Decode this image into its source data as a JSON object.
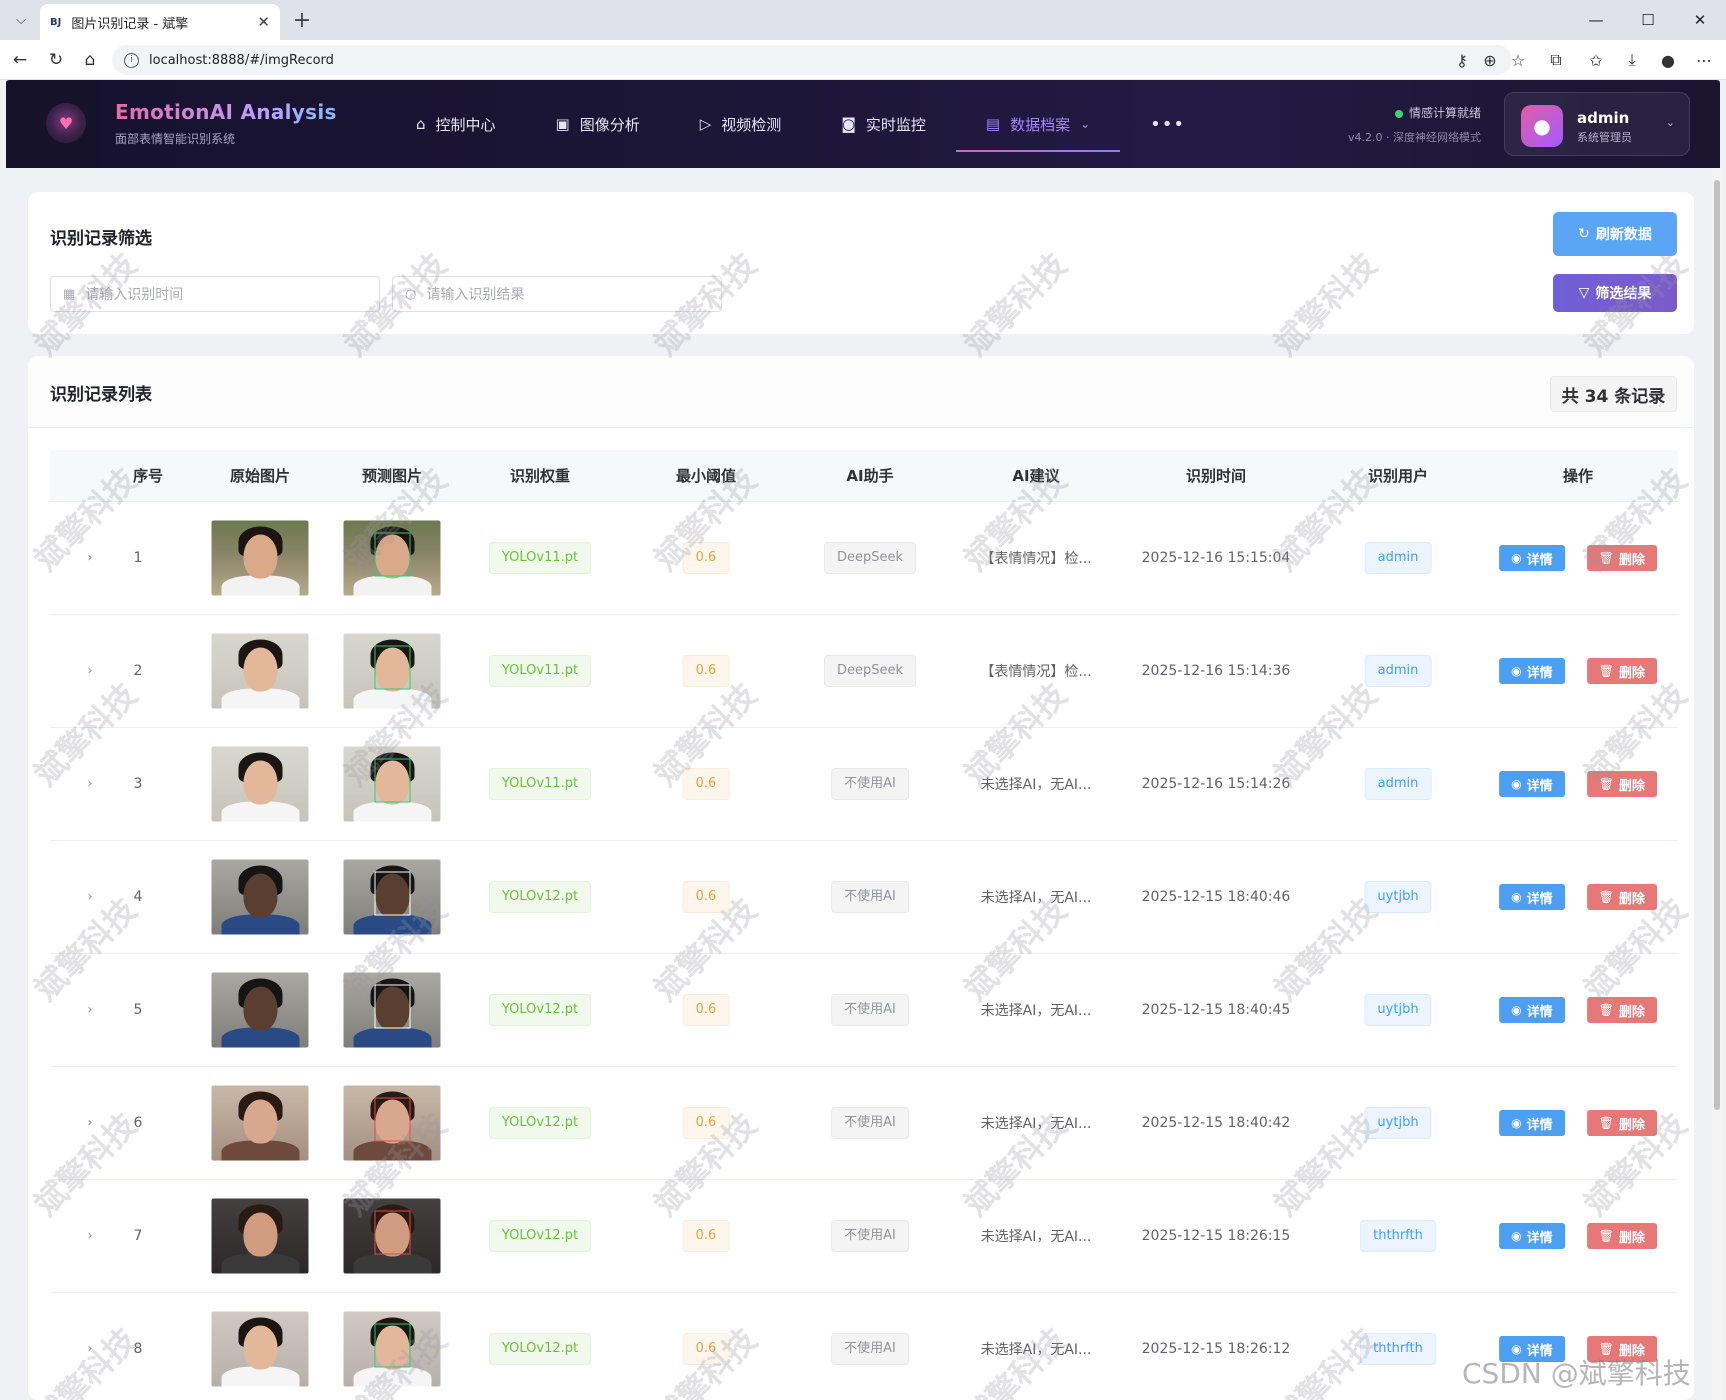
{
  "browser": {
    "tab_title": "图片识别记录 - 斌擎",
    "tab_favicon": "BJ",
    "url": "localhost:8888/#/imgRecord"
  },
  "app": {
    "brand_title": "EmotionAI Analysis",
    "brand_subtitle": "面部表情智能识别系统",
    "nav": [
      {
        "label": "控制中心",
        "icon": "home-icon"
      },
      {
        "label": "图像分析",
        "icon": "image-icon"
      },
      {
        "label": "视频检测",
        "icon": "play-circle-icon"
      },
      {
        "label": "实时监控",
        "icon": "camera-icon"
      },
      {
        "label": "数据档案",
        "icon": "document-icon",
        "active": true
      }
    ],
    "more": "•••",
    "status_text": "情感计算就绪",
    "status_sub": "v4.2.0 · 深度神经网络模式",
    "user_name": "admin",
    "user_role": "系统管理员"
  },
  "filter": {
    "title": "识别记录筛选",
    "time_placeholder": "请输入识别时间",
    "result_placeholder": "请输入识别结果",
    "refresh_label": "刷新数据",
    "filter_label": "筛选结果"
  },
  "list": {
    "title": "识别记录列表",
    "count_label": "共 34 条记录",
    "columns": [
      "序号",
      "原始图片",
      "预测图片",
      "识别权重",
      "最小阈值",
      "AI助手",
      "AI建议",
      "识别时间",
      "识别用户",
      "操作"
    ],
    "view_label": "详情",
    "delete_label": "删除",
    "rows": [
      {
        "index": "1",
        "weight": "YOLOv11.pt",
        "threshold": "0.6",
        "ai": "DeepSeek",
        "advice": "【表情情况】检...",
        "time": "2025-12-16 15:15:04",
        "user": "admin"
      },
      {
        "index": "2",
        "weight": "YOLOv11.pt",
        "threshold": "0.6",
        "ai": "DeepSeek",
        "advice": "【表情情况】检...",
        "time": "2025-12-16 15:14:36",
        "user": "admin"
      },
      {
        "index": "3",
        "weight": "YOLOv11.pt",
        "threshold": "0.6",
        "ai": "不使用AI",
        "advice": "未选择AI，无AI...",
        "time": "2025-12-16 15:14:26",
        "user": "admin"
      },
      {
        "index": "4",
        "weight": "YOLOv12.pt",
        "threshold": "0.6",
        "ai": "不使用AI",
        "advice": "未选择AI，无AI...",
        "time": "2025-12-15 18:40:46",
        "user": "uytjbh"
      },
      {
        "index": "5",
        "weight": "YOLOv12.pt",
        "threshold": "0.6",
        "ai": "不使用AI",
        "advice": "未选择AI，无AI...",
        "time": "2025-12-15 18:40:45",
        "user": "uytjbh"
      },
      {
        "index": "6",
        "weight": "YOLOv12.pt",
        "threshold": "0.6",
        "ai": "不使用AI",
        "advice": "未选择AI，无AI...",
        "time": "2025-12-15 18:40:42",
        "user": "uytjbh"
      },
      {
        "index": "7",
        "weight": "YOLOv12.pt",
        "threshold": "0.6",
        "ai": "不使用AI",
        "advice": "未选择AI，无AI...",
        "time": "2025-12-15 18:26:15",
        "user": "ththrfth"
      },
      {
        "index": "8",
        "weight": "YOLOv12.pt",
        "threshold": "0.6",
        "ai": "不使用AI",
        "advice": "未选择AI，无AI...",
        "time": "2025-12-15 18:26:12",
        "user": "ththrfth"
      }
    ]
  },
  "watermark": "斌擎科技",
  "footer_mark": "CSDN @斌擎科技",
  "colors": {
    "accent": "#409eff",
    "brand_purple": "#a487ff",
    "danger": "#e67878"
  }
}
